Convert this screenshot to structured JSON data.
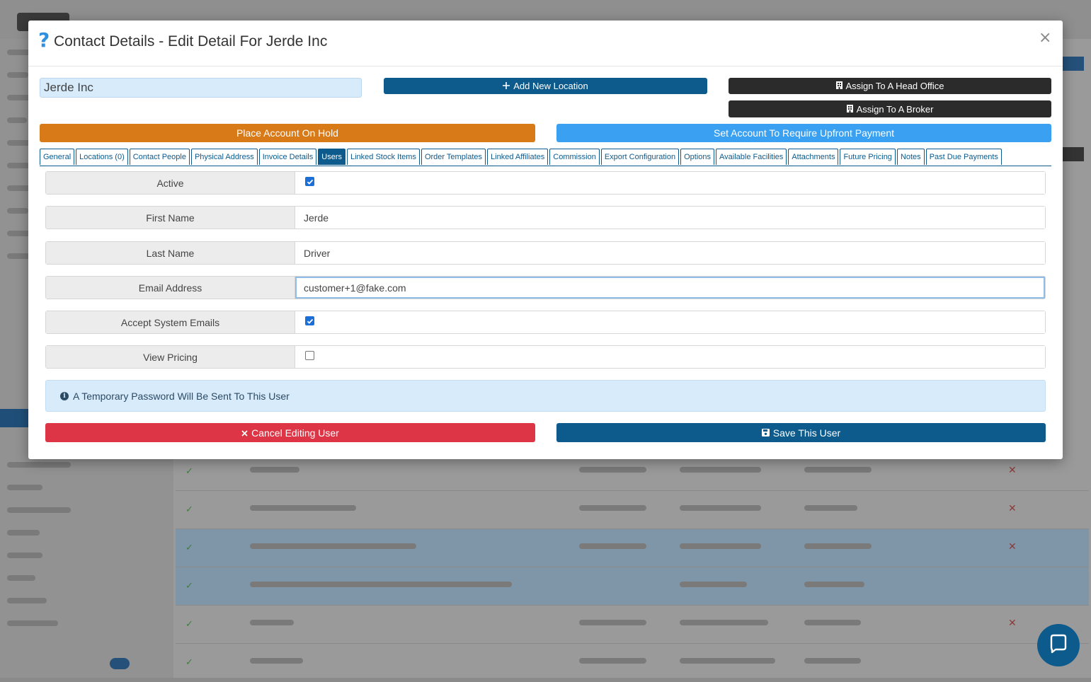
{
  "modal": {
    "title": "Contact Details - Edit Detail For Jerde Inc",
    "close": "×",
    "help": "?"
  },
  "account": {
    "name_value": "Jerde Inc"
  },
  "actions": {
    "add_location": "Add New Location",
    "assign_head_office": "Assign To A Head Office",
    "assign_broker": "Assign To A Broker",
    "place_on_hold": "Place Account On Hold",
    "require_upfront": "Set Account To Require Upfront Payment"
  },
  "tabs": [
    {
      "label": "General",
      "active": false
    },
    {
      "label": "Locations (0)",
      "active": false
    },
    {
      "label": "Contact People",
      "active": false
    },
    {
      "label": "Physical Address",
      "active": false
    },
    {
      "label": "Invoice Details",
      "active": false
    },
    {
      "label": "Users",
      "active": true
    },
    {
      "label": "Linked Stock Items",
      "active": false
    },
    {
      "label": "Order Templates",
      "active": false
    },
    {
      "label": "Linked Affiliates",
      "active": false
    },
    {
      "label": "Commission",
      "active": false
    },
    {
      "label": "Export Configuration",
      "active": false
    },
    {
      "label": "Options",
      "active": false
    },
    {
      "label": "Available Facilities",
      "active": false
    },
    {
      "label": "Attachments",
      "active": false
    },
    {
      "label": "Future Pricing",
      "active": false
    },
    {
      "label": "Notes",
      "active": false
    },
    {
      "label": "Past Due Payments",
      "active": false
    }
  ],
  "user_form": {
    "active": {
      "label": "Active",
      "checked": true
    },
    "first_name": {
      "label": "First Name",
      "value": "Jerde"
    },
    "last_name": {
      "label": "Last Name",
      "value": "Driver"
    },
    "email": {
      "label": "Email Address",
      "value": "customer+1@fake.com"
    },
    "accept_emails": {
      "label": "Accept System Emails",
      "checked": true
    },
    "view_pricing": {
      "label": "View Pricing",
      "checked": false
    }
  },
  "info": {
    "message": "A Temporary Password Will Be Sent To This User"
  },
  "footer": {
    "cancel": "Cancel Editing User",
    "save": "Save This User"
  },
  "icons": {
    "add": "plus-icon",
    "building": "building-icon",
    "info": "info-icon",
    "cancel": "times-icon",
    "save": "floppy-icon",
    "chat": "chat-icon"
  },
  "colors": {
    "primary": "#0d5a8c",
    "dark": "#2b2b2b",
    "warning": "#d97a18",
    "info": "#3aa0f1",
    "danger": "#dd3545",
    "info_bg": "#d7ebfb"
  }
}
